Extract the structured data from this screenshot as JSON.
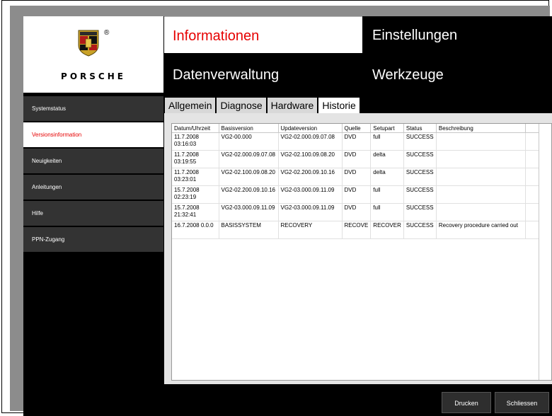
{
  "header": {
    "brand_wordmark": "PORSCHE",
    "registered_mark": "®",
    "nav": {
      "informationen": "Informationen",
      "einstellungen": "Einstellungen",
      "datenverwaltung": "Datenverwaltung",
      "werkzeuge": "Werkzeuge"
    }
  },
  "sidebar": {
    "items": [
      {
        "label": "Systemstatus"
      },
      {
        "label": "Versionsinformation"
      },
      {
        "label": "Neuigkeiten"
      },
      {
        "label": "Anleitungen"
      },
      {
        "label": "Hilfe"
      },
      {
        "label": "PPN-Zugang"
      }
    ]
  },
  "tabs": [
    "Allgemein",
    "Diagnose",
    "Hardware",
    "Historie"
  ],
  "table": {
    "columns": [
      "Datum/Uhrzeit",
      "Basisversion",
      "Updateversion",
      "Quelle",
      "Setupart",
      "Status",
      "Beschreibung"
    ],
    "rows": [
      [
        "11.7.2008\n03:16:03",
        "VG2-00.000",
        "VG2-02.000.09.07.08",
        "DVD",
        "full",
        "SUCCESS",
        ""
      ],
      [
        "11.7.2008\n03:19:55",
        "VG2-02.000.09.07.08",
        "VG2-02.100.09.08.20",
        "DVD",
        "delta",
        "SUCCESS",
        ""
      ],
      [
        "11.7.2008\n03:23:01",
        "VG2-02.100.09.08.20",
        "VG2-02.200.09.10.16",
        "DVD",
        "delta",
        "SUCCESS",
        ""
      ],
      [
        "15.7.2008\n02:23:19",
        "VG2-02.200.09.10.16",
        "VG2-03.000.09.11.09",
        "DVD",
        "full",
        "SUCCESS",
        ""
      ],
      [
        "15.7.2008\n21:32:41",
        "VG2-03.000.09.11.09",
        "VG2-03.000.09.11.09",
        "DVD",
        "full",
        "SUCCESS",
        ""
      ],
      [
        "16.7.2008 0.0.0",
        "BASISSYSTEM",
        "RECOVERY",
        "RECOVE",
        "RECOVER",
        "SUCCESS",
        "Recovery procedure carried out"
      ]
    ]
  },
  "buttons": {
    "print": "Drucken",
    "close": "Schliessen"
  },
  "colors": {
    "accent": "#e60000",
    "nav_bg": "#000000",
    "sidebar_bg": "#333333",
    "panel_bg": "#e4e4e4"
  }
}
